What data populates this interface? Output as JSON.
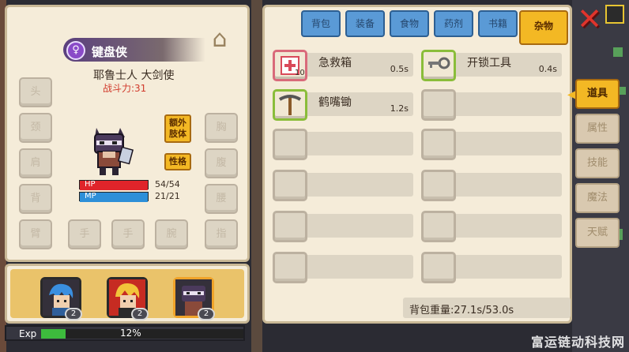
{
  "character": {
    "name": "键盘侠",
    "title": "耶鲁士人 大剑使",
    "power": "战斗力:31",
    "name_icon": "person-icon",
    "hanger_icon": "hanger-icon"
  },
  "slots": {
    "left": [
      "头",
      "颈",
      "肩",
      "背",
      "臂"
    ],
    "right": [
      "胸",
      "腹",
      "腰",
      "指"
    ],
    "bottom": [
      "手",
      "手",
      "腕"
    ]
  },
  "buttons": {
    "extra_limb": "额外\n肢体",
    "personality": "性格"
  },
  "stats": {
    "hp_label": "HP",
    "hp_value": "54/54",
    "hp_fraction": 1.0,
    "mp_label": "MP",
    "mp_value": "21/21",
    "mp_fraction": 1.0,
    "hp_color": "#e0242a",
    "mp_color": "#2d8fd8"
  },
  "party": [
    {
      "level": "2",
      "active": false
    },
    {
      "level": "2",
      "active": false
    },
    {
      "level": "2",
      "active": true
    }
  ],
  "exp": {
    "label": "Exp",
    "percent_text": "12%",
    "fraction": 0.12
  },
  "tabs": [
    "背包",
    "装备",
    "食物",
    "药剂",
    "书籍",
    "杂物"
  ],
  "active_tab": "杂物",
  "items": [
    {
      "name": "急救箱",
      "weight": "0.5s",
      "count": "10",
      "icon": "first-aid-kit-icon"
    },
    {
      "name": "开锁工具",
      "weight": "0.4s",
      "count": "",
      "icon": "lockpick-icon"
    },
    {
      "name": "鹤嘴锄",
      "weight": "1.2s",
      "count": "",
      "icon": "pickaxe-icon"
    }
  ],
  "weight": "背包重量:27.1s/53.0s",
  "side_tabs": [
    "道具",
    "属性",
    "技能",
    "魔法",
    "天赋"
  ],
  "active_side_tab": "道具",
  "close_icon": "close-icon",
  "watermark": "富运链动科技网"
}
